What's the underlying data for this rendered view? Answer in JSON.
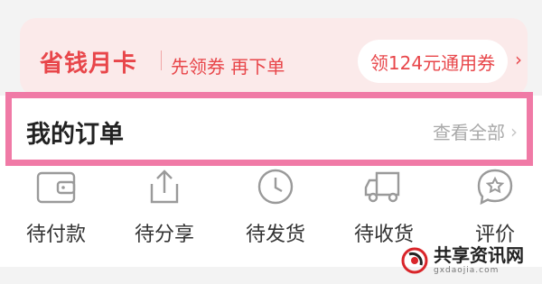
{
  "promo": {
    "title": "省钱月卡",
    "subtitle": "先领券 再下单",
    "coupon_label": "领124元通用券",
    "chevron": "›"
  },
  "orders": {
    "title": "我的订单",
    "view_all_label": "查看全部",
    "view_all_chevron": "›"
  },
  "statuses": [
    {
      "label": "待付款",
      "icon": "wallet-icon"
    },
    {
      "label": "待分享",
      "icon": "share-icon"
    },
    {
      "label": "待发货",
      "icon": "clock-icon"
    },
    {
      "label": "待收货",
      "icon": "truck-icon"
    },
    {
      "label": "评价",
      "icon": "review-star-icon"
    }
  ],
  "watermark": {
    "name": "共享资讯网",
    "url": "gxdaojia.com"
  },
  "colors": {
    "accent": "#e8464a",
    "promo_bg": "#fbeaea",
    "highlight_border": "#f07aa6",
    "muted_text": "#a9a9a9"
  }
}
